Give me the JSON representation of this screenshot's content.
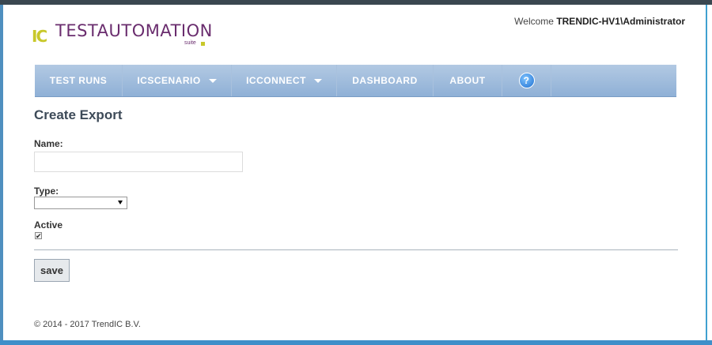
{
  "header": {
    "welcome_prefix": "Welcome",
    "user": "TRENDIC-HV1\\Administrator"
  },
  "logo": {
    "mark": "IC",
    "text": "TESTAUTOMATION",
    "suite": "suite"
  },
  "nav": {
    "items": [
      {
        "label": "TEST RUNS",
        "dropdown": false
      },
      {
        "label": "ICSCENARIO",
        "dropdown": true
      },
      {
        "label": "ICCONNECT",
        "dropdown": true
      },
      {
        "label": "DASHBOARD",
        "dropdown": false
      },
      {
        "label": "ABOUT",
        "dropdown": false
      }
    ],
    "help_icon": "question-circle-icon"
  },
  "form": {
    "title": "Create Export",
    "name_label": "Name:",
    "name_value": "",
    "type_label": "Type:",
    "type_value": "",
    "active_label": "Active",
    "active_checked": true,
    "save_label": "save"
  },
  "footer": {
    "copyright": "© 2014 - 2017 TrendIC B.V."
  },
  "colors": {
    "nav_bg": "#9fbde0",
    "logo_purple": "#6a2d6e",
    "logo_yellow": "#c8c82a",
    "frame_border": "#3fa0d0"
  }
}
